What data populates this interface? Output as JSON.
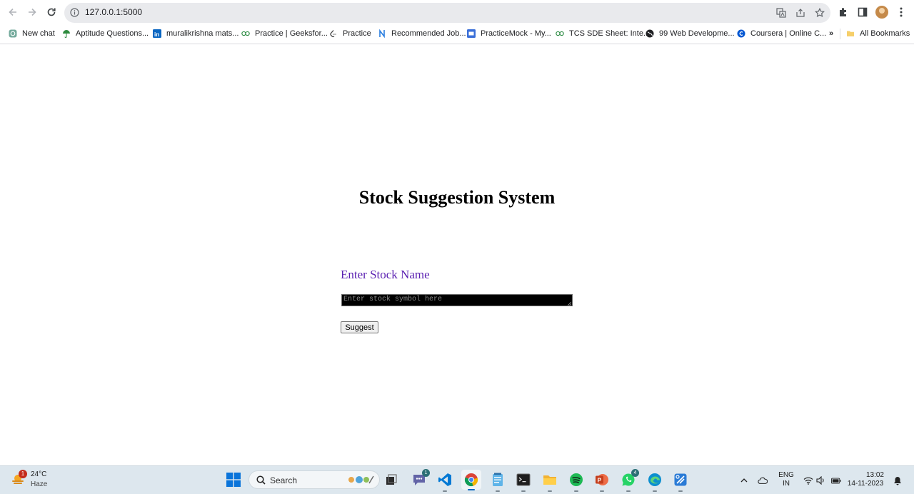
{
  "browser": {
    "url": "127.0.0.1:5000",
    "bookmarks": [
      {
        "label": "New chat",
        "icon": "chatgpt-icon"
      },
      {
        "label": "Aptitude Questions...",
        "icon": "umbrella-icon"
      },
      {
        "label": "muralikrishna mats...",
        "icon": "linkedin-icon"
      },
      {
        "label": "Practice | Geeksfor...",
        "icon": "geeksforgeeks-icon"
      },
      {
        "label": "Practice",
        "icon": "leetcode-icon"
      },
      {
        "label": "Recommended Job...",
        "icon": "naukri-icon"
      },
      {
        "label": "PracticeMock - My...",
        "icon": "practicemock-icon"
      },
      {
        "label": "TCS SDE Sheet: Inte...",
        "icon": "geeksforgeeks-icon"
      },
      {
        "label": "99 Web Developme...",
        "icon": "globe-icon"
      },
      {
        "label": "Coursera | Online C...",
        "icon": "coursera-icon"
      }
    ],
    "more_bookmarks": "»",
    "all_bookmarks": "All Bookmarks"
  },
  "page": {
    "title": "Stock Suggestion System",
    "input_label": "Enter Stock Name",
    "input_placeholder": "Enter stock symbol here",
    "input_value": "",
    "button_label": "Suggest"
  },
  "taskbar": {
    "weather": {
      "temp": "24°C",
      "condition": "Haze",
      "badge": "1"
    },
    "search_label": "Search",
    "teams_badge": "1",
    "whatsapp_badge": "4",
    "language_top": "ENG",
    "language_bottom": "IN",
    "time": "13:02",
    "date": "14-11-2023"
  },
  "colors": {
    "label_purple": "#5a1fb1",
    "input_bg": "#000000",
    "taskbar_bg": "#dde7ee"
  }
}
